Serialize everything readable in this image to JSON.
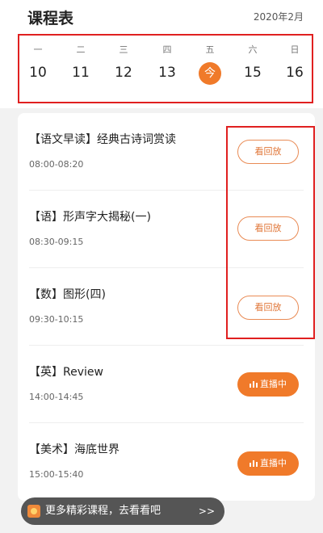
{
  "header": {
    "title": "课程表",
    "month": "2020年2月"
  },
  "week": [
    {
      "dow": "一",
      "date": "10"
    },
    {
      "dow": "二",
      "date": "11"
    },
    {
      "dow": "三",
      "date": "12"
    },
    {
      "dow": "四",
      "date": "13"
    },
    {
      "dow": "五",
      "date": "今",
      "today": true
    },
    {
      "dow": "六",
      "date": "15"
    },
    {
      "dow": "日",
      "date": "16"
    }
  ],
  "courses": [
    {
      "name": "【语文早读】经典古诗词赏读",
      "time": "08:00-08:20",
      "action": "看回放",
      "kind": "replay"
    },
    {
      "name": "【语】形声字大揭秘(一)",
      "time": "08:30-09:15",
      "action": "看回放",
      "kind": "replay"
    },
    {
      "name": "【数】图形(四)",
      "time": "09:30-10:15",
      "action": "看回放",
      "kind": "replay"
    },
    {
      "name": "【英】Review",
      "time": "14:00-14:45",
      "action": "直播中",
      "kind": "live"
    },
    {
      "name": "【美术】海底世界",
      "time": "15:00-15:40",
      "action": "直播中",
      "kind": "live"
    }
  ],
  "more_banner": {
    "label": "更多精彩课程，去看看吧",
    "arrow": ">>"
  },
  "colors": {
    "accent": "#f07a2a",
    "highlight_box": "#e02020"
  }
}
